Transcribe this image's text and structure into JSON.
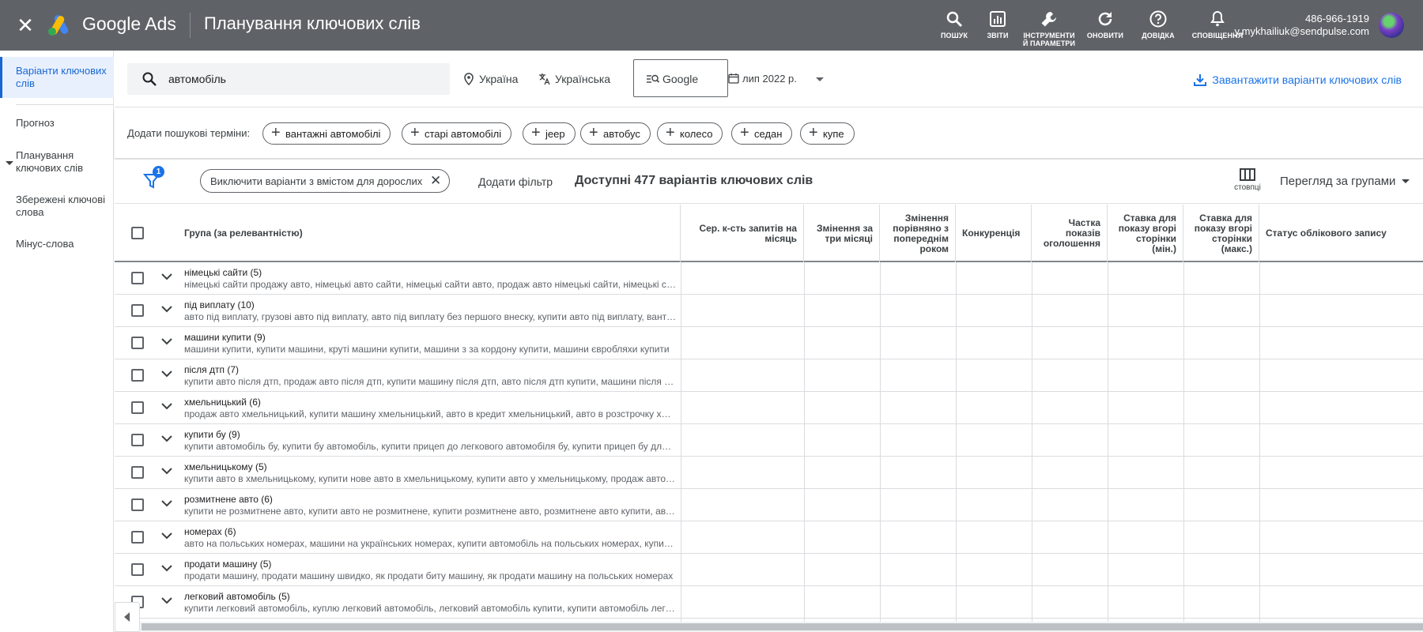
{
  "header": {
    "brand": "Google Ads",
    "page_title": "Планування ключових слів",
    "tools": [
      {
        "label": "ПОШУК",
        "icon": "search-icon"
      },
      {
        "label": "ЗВІТИ",
        "icon": "reports-icon"
      },
      {
        "label": "ІНСТРУМЕНТИ Й ПАРАМЕТРИ",
        "icon": "wrench-icon"
      },
      {
        "label": "ОНОВИТИ",
        "icon": "refresh-icon"
      },
      {
        "label": "ДОВІДКА",
        "icon": "help-icon"
      },
      {
        "label": "СПОВІЩЕННЯ",
        "icon": "bell-icon"
      }
    ],
    "account_id": "486-966-1919",
    "account_email": "y.mykhailiuk@sendpulse.com"
  },
  "sidebar": {
    "items": [
      {
        "label": "Варіанти ключових слів",
        "active": true
      },
      {
        "label": "Прогноз"
      },
      {
        "label": "Планування ключових слів",
        "expandable": true
      },
      {
        "label": "Збережені ключові слова"
      },
      {
        "label": "Мінус-слова"
      }
    ]
  },
  "search": {
    "query": "автомобіль",
    "location": "Україна",
    "language": "Українська",
    "engine": "Google",
    "date_range": "лип 2022 р.",
    "download_label": "Завантажити варіанти ключових слів"
  },
  "add_terms": {
    "label": "Додати пошукові терміни:",
    "chips": [
      "вантажні автомобілі",
      "старі автомобілі",
      "jeep",
      "автобус",
      "колесо",
      "седан",
      "купе"
    ]
  },
  "filters": {
    "badge_count": "1",
    "active_filter": "Виключити варіанти з вмістом для дорослих",
    "add_filter_label": "Додати фільтр",
    "available_text": "Доступні 477 варіантів ключових слів",
    "columns_label": "стовпці",
    "view_label": "Перегляд за групами"
  },
  "table": {
    "columns": [
      "Група (за релевантністю)",
      "Сер. к-сть запитів на місяць",
      "Змінення за три місяці",
      "Змінення порівняно з попереднім роком",
      "Конкуренція",
      "Частка показів оголошення",
      "Ставка для показу вгорі сторінки (мін.)",
      "Ставка для показу вгорі сторінки (макс.)",
      "Статус облікового запису"
    ],
    "rows": [
      {
        "title": "німецькі сайти (5)",
        "keywords": "німецькі сайти продажу авто, німецькі авто сайти, німецькі сайти авто, продаж авто німецькі сайти, німецькі сайти продажу автомобілів"
      },
      {
        "title": "під виплату (10)",
        "keywords": "авто під виплату, грузові авто під виплату, авто під виплату без першого внеску, купити авто під виплату, вантажні авто під виплату"
      },
      {
        "title": "машини купити (9)",
        "keywords": "машини купити, купити машини, круті машини купити, машини з за кордону купити, машини євробляхи купити"
      },
      {
        "title": "після дтп (7)",
        "keywords": "купити авто після дтп, продаж авто після дтп, купити машину після дтп, авто після дтп купити, машини після дтп"
      },
      {
        "title": "хмельницький (6)",
        "keywords": "продаж авто хмельницький, купити машину хмельницький, авто в кредит хмельницький, авто в розстрочку хмельницький"
      },
      {
        "title": "купити бу (9)",
        "keywords": "купити автомобіль бу, купити бу автомобіль, купити прицеп до легкового автомобіля бу, купити прицеп бу для легкового"
      },
      {
        "title": "хмельницькому (5)",
        "keywords": "купити авто в хмельницькому, купити нове авто в хмельницькому, купити авто у хмельницькому, продаж авто в хмельницькому"
      },
      {
        "title": "розмитнене авто (6)",
        "keywords": "купити не розмитнене авто, купити авто не розмитнене, купити розмитнене авто, розмитнене авто купити, авто розмитнене"
      },
      {
        "title": "номерах (6)",
        "keywords": "авто на польських номерах, машини на українських номерах, купити автомобіль на польських номерах, купити авто на номерах"
      },
      {
        "title": "продати машину (5)",
        "keywords": "продати машину, продати машину швидко, як продати биту машину, як продати машину на польських номерах"
      },
      {
        "title": "легковий автомобіль (5)",
        "keywords": "купити легковий автомобіль, куплю легковий автомобіль, легковий автомобіль купити, купити автомобіль легковий"
      }
    ]
  }
}
